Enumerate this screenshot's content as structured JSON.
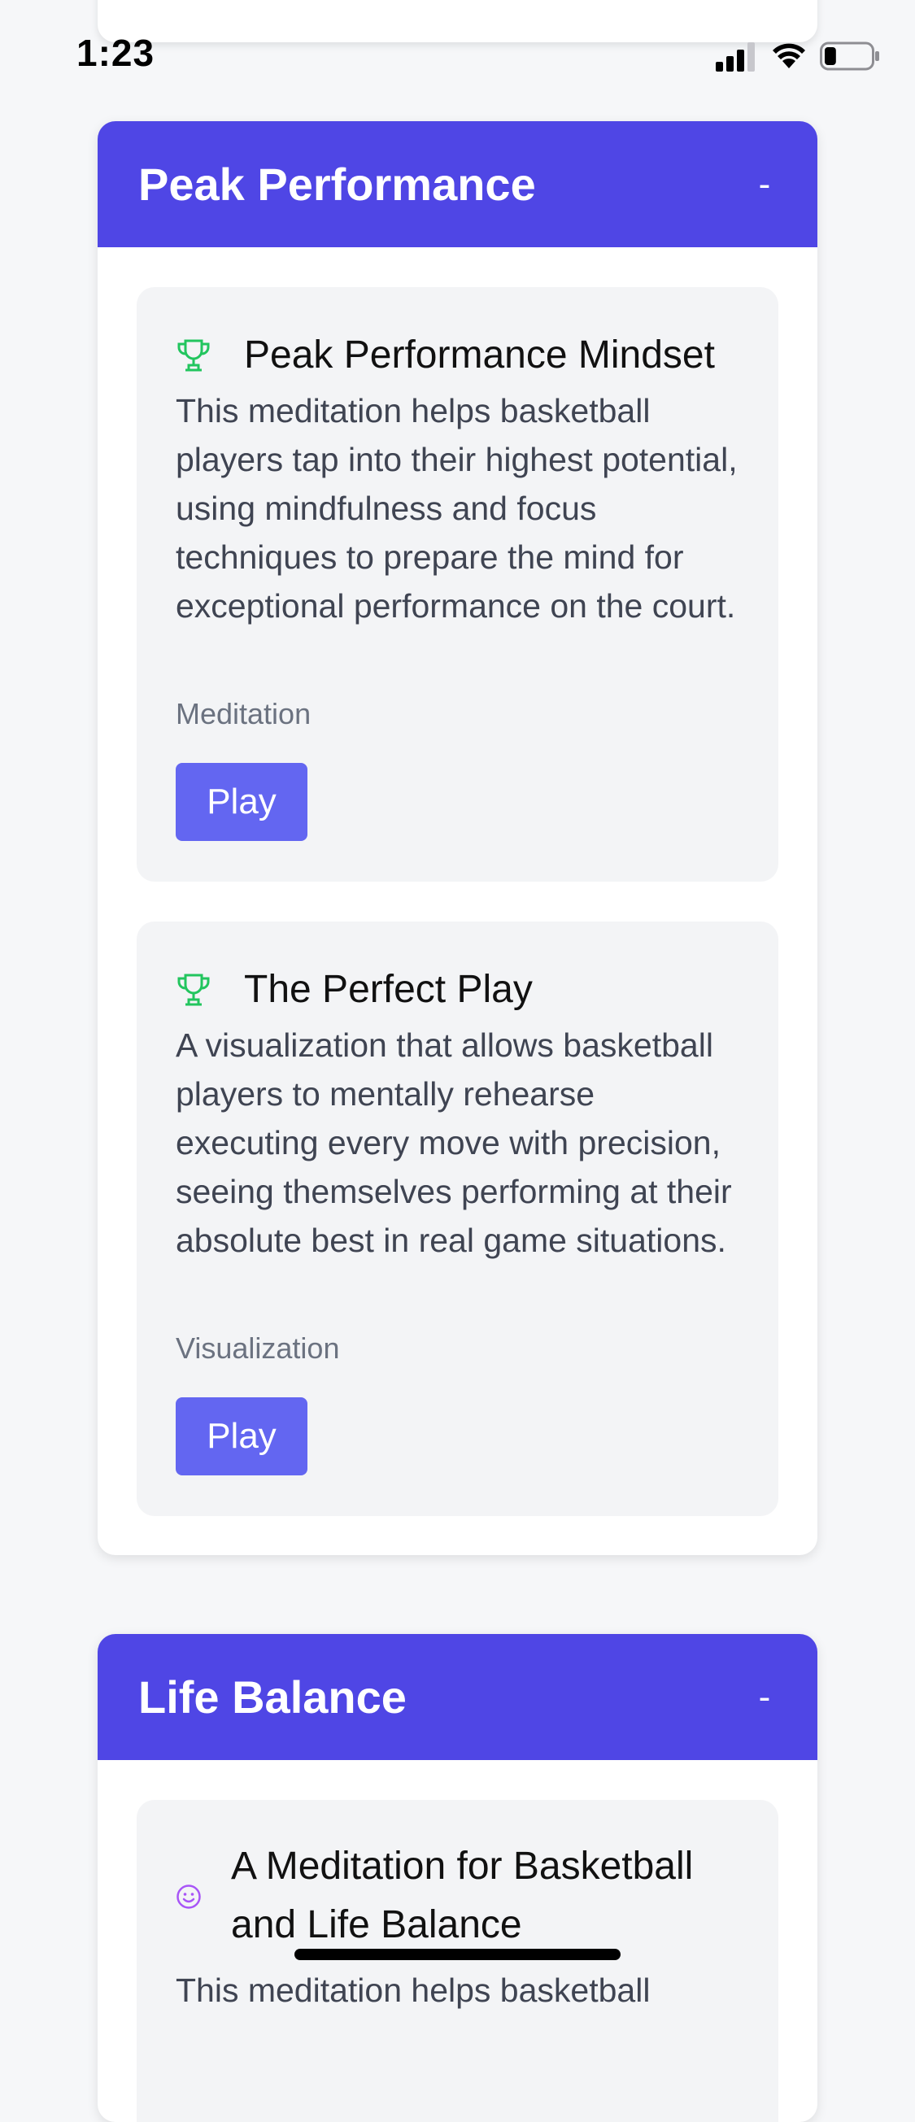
{
  "status_bar": {
    "time": "1:23",
    "battery_level": 0.25
  },
  "sections": [
    {
      "title": "Peak Performance",
      "toggle": "-",
      "items": [
        {
          "icon": "trophy-icon",
          "title": "Peak Performance Mindset",
          "description": "This meditation helps basketball players tap into their highest potential, using mindfulness and focus techniques to prepare the mind for exceptional performance on the court.",
          "category": "Meditation",
          "button_label": "Play"
        },
        {
          "icon": "trophy-icon",
          "title": "The Perfect Play",
          "description": "A visualization that allows basketball players to mentally rehearse executing every move with precision, seeing themselves performing at their absolute best in real game situations.",
          "category": "Visualization",
          "button_label": "Play"
        }
      ]
    },
    {
      "title": "Life Balance",
      "toggle": "-",
      "items": [
        {
          "icon": "smile-icon",
          "title": "A Meditation for Basketball and Life Balance",
          "description": "This meditation helps basketball"
        }
      ]
    }
  ],
  "colors": {
    "header": "#4f46e5",
    "button": "#6366f1",
    "trophy": "#22c55e",
    "smile": "#a855f7"
  }
}
